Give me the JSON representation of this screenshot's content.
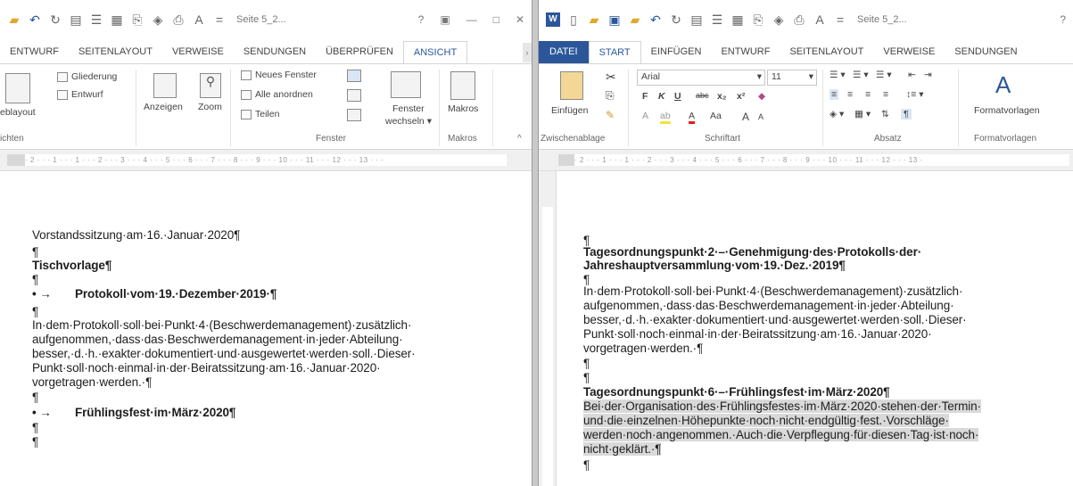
{
  "left": {
    "qat_title": "Seite 5_2...",
    "tabs": [
      "ENTWURF",
      "SEITENLAYOUT",
      "VERWEISE",
      "SENDUNGEN",
      "ÜBERPRÜFEN",
      "ANSICHT"
    ],
    "ribbon": {
      "web_layout": "eblayout",
      "outline": "Gliederung",
      "draft": "Entwurf",
      "show": "Anzeigen",
      "zoom": "Zoom",
      "new_window": "Neues Fenster",
      "arrange_all": "Alle anordnen",
      "split": "Teilen",
      "switch_windows_1": "Fenster",
      "switch_windows_2": "wechseln",
      "macros": "Makros",
      "group_views": "ichten",
      "group_window": "Fenster",
      "group_macros": "Makros"
    },
    "ruler": "· 2 · · · 1 · · · 1 · · · 2 · · · 3 · · · 4 · · · 5 · · · 6 · · · 7 · · · 8 · · · 9 · · · 10 · · · 11 · · · 12 · · · 13 · · ·",
    "doc": {
      "line1": "Vorstandssitzung·am·16.·Januar·2020¶",
      "p1": "¶",
      "line2": "Tischvorlage¶",
      "p2": "¶",
      "bullet1_mark": "•  →",
      "bullet1": "Protokoll·vom·19.·Dezember·2019·¶",
      "p3": "¶",
      "body1": "In·dem·Protokoll·soll·bei·Punkt·4·(Beschwerdemanagement)·zusätzlich·",
      "body2": "aufgenommen,·dass·das·Beschwerdemanagement·in·jeder·Abteilung·",
      "body3": "besser,·d.·h.·exakter·dokumentiert·und·ausgewertet·werden·soll.·Dieser·",
      "body4": "Punkt·soll·noch·einmal·in·der·Beiratssitzung·am·16.·Januar·2020·",
      "body5": "vorgetragen·werden.·¶",
      "p4": "¶",
      "bullet2_mark": "•  →",
      "bullet2": "Frühlingsfest·im·März·2020¶",
      "p5": "¶",
      "p6": "¶"
    }
  },
  "right": {
    "qat_title": "Seite 5_2...",
    "tabs": [
      "DATEI",
      "START",
      "EINFÜGEN",
      "ENTWURF",
      "SEITENLAYOUT",
      "VERWEISE",
      "SENDUNGEN"
    ],
    "ribbon": {
      "paste": "Einfügen",
      "font_name": "Arial",
      "font_size": "11",
      "bold": "F",
      "italic": "K",
      "underline": "U",
      "strike": "abc",
      "sub": "x₂",
      "sup": "x²",
      "change_case": "Aa",
      "grow": "A",
      "shrink": "A",
      "styles": "Formatvorlagen",
      "group_clipboard": "Zwischenablage",
      "group_font": "Schriftart",
      "group_paragraph": "Absatz",
      "group_styles": "Formatvorlagen"
    },
    "ruler": "· 2 · · · 1 · · · 1 · · · 2 · · · 3 · · · 4 · · · 5 · · · 6 · · · 7 · · · 8 · · · 9 · · · 10 · · · 11 · · · 12 · · · 13 ·",
    "doc": {
      "p0": "¶",
      "h1a": "Tagesordnungspunkt·2·–·Genehmigung·des·Protokolls·der·",
      "h1b": "Jahreshauptversammlung·vom·19.·Dez.·2019¶",
      "p1": "¶",
      "b1": "In·dem·Protokoll·soll·bei·Punkt·4·(Beschwerdemanagement)·zusätzlich·",
      "b2": "aufgenommen,·dass·das·Beschwerdemanagement·in·jeder·Abteilung·",
      "b3": "besser,·d.·h.·exakter·dokumentiert·und·ausgewertet·werden·soll.·Dieser·",
      "b4": "Punkt·soll·noch·einmal·in·der·Beiratssitzung·am·16.·Januar·2020·",
      "b5": "vorgetragen·werden.·¶",
      "p2": "¶",
      "p3": "¶",
      "h2": "Tagesordnungspunkt·6·–·Frühlingsfest·im·März·2020¶",
      "s1": "Bei·der·Organisation·des·Frühlingsfestes·im·März·2020·stehen·der·Termin·",
      "s2": "und·die·einzelnen·Höhepunkte·noch·nicht·endgültig·fest.·Vorschläge·",
      "s3": "werden·noch·angenommen.·Auch·die·Verpflegung·für·diesen·Tag·ist·noch·",
      "s4": "nicht·geklärt.·¶",
      "p4": "¶"
    }
  }
}
